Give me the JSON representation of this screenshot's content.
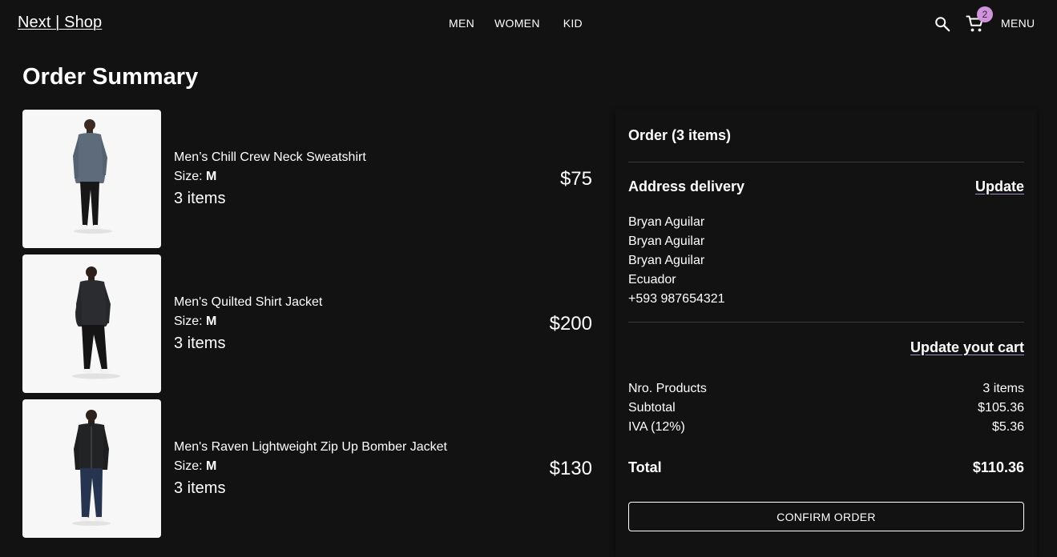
{
  "header": {
    "brand": "Next | Shop",
    "nav": [
      "MEN",
      "WOMEN",
      "KID"
    ],
    "cart_count": "2",
    "menu_label": "MENU",
    "icons": {
      "search": "search-icon",
      "cart": "shopping-cart-icon"
    }
  },
  "page": {
    "title": "Order Summary"
  },
  "items": [
    {
      "name": "Men’s Chill Crew Neck Sweatshirt",
      "size_label": "Size: ",
      "size": "M",
      "quantity": "3 items",
      "price": "$75",
      "image": "man-grey-sweatshirt-photo"
    },
    {
      "name": "Men's Quilted Shirt Jacket",
      "size_label": "Size: ",
      "size": "M",
      "quantity": "3 items",
      "price": "$200",
      "image": "man-black-quilted-jacket-photo"
    },
    {
      "name": "Men's Raven Lightweight Zip Up Bomber Jacket",
      "size_label": "Size: ",
      "size": "M",
      "quantity": "3 items",
      "price": "$130",
      "image": "man-black-bomber-jacket-photo"
    }
  ],
  "summary": {
    "order_title": "Order (3 items)",
    "address_title": "Address delivery",
    "update_link": "Update",
    "address": [
      "Bryan Aguilar",
      "Bryan Aguilar",
      "Bryan Aguilar",
      "Ecuador",
      "+593 987654321"
    ],
    "update_cart_link": "Update yout cart",
    "rows": [
      {
        "label": "Nro. Products",
        "value": "3 items"
      },
      {
        "label": "Subtotal",
        "value": "$105.36"
      },
      {
        "label": "IVA (12%)",
        "value": "$5.36"
      }
    ],
    "total_label": "Total",
    "total_value": "$110.36",
    "confirm_label": "CONFIRM ORDER"
  },
  "colors": {
    "background": "#121212",
    "text": "#ffffff",
    "badge": "#ce93d8",
    "link_underline": "#a28cc8",
    "divider": "#3a3a3a"
  }
}
